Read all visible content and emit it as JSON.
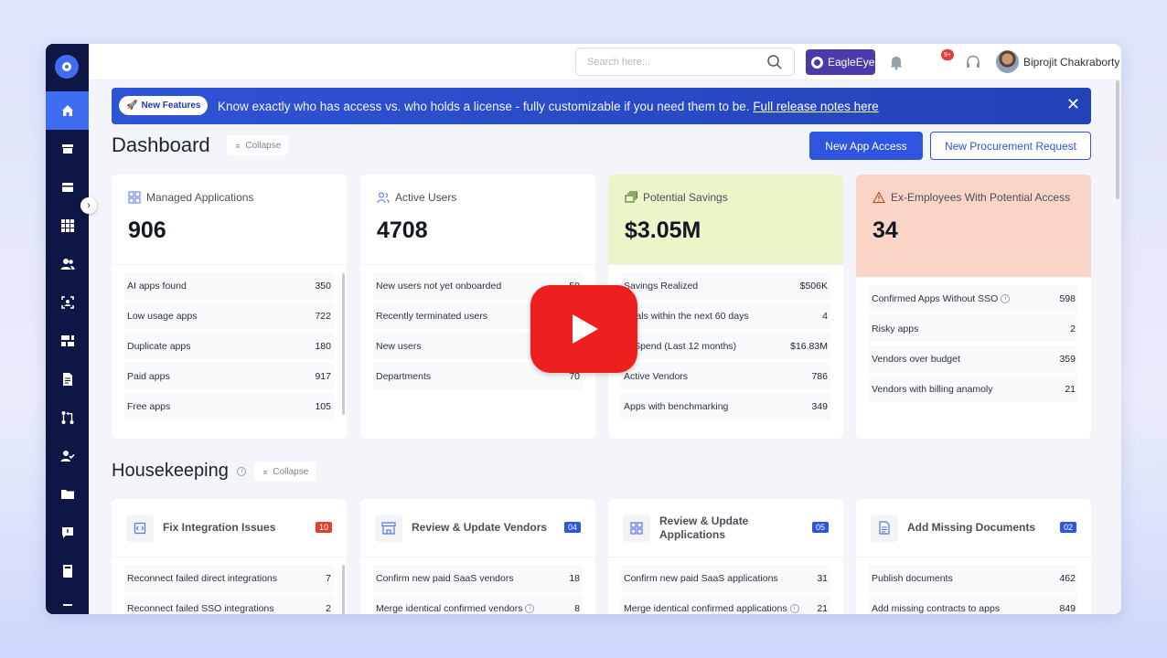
{
  "search": {
    "placeholder": "Search here..."
  },
  "header": {
    "brand_label": "EagleEye",
    "notif_count": "9+",
    "user_name": "Biprojit Chakraborty"
  },
  "banner": {
    "pill": "New Features",
    "message": "Know exactly who has access vs. who holds a license - fully customizable if you need them to be.",
    "link": "Full release notes here"
  },
  "dashboard": {
    "title": "Dashboard",
    "collapse_label": "Collapse",
    "new_app_access": "New App Access",
    "new_procurement": "New Procurement Request"
  },
  "cards": [
    {
      "title": "Managed Applications",
      "value": "906",
      "rows": [
        {
          "label": "AI apps found",
          "value": "350"
        },
        {
          "label": "Low usage apps",
          "value": "722"
        },
        {
          "label": "Duplicate apps",
          "value": "180"
        },
        {
          "label": "Paid apps",
          "value": "917"
        },
        {
          "label": "Free apps",
          "value": "105"
        }
      ]
    },
    {
      "title": "Active Users",
      "value": "4708",
      "rows": [
        {
          "label": "New users not yet onboarded",
          "value": "50"
        },
        {
          "label": "Recently terminated users",
          "value": ""
        },
        {
          "label": "New users",
          "value": ""
        },
        {
          "label": "Departments",
          "value": "70"
        }
      ]
    },
    {
      "title": "Potential Savings",
      "value": "$3.05M",
      "rows": [
        {
          "label": "Savings Realized",
          "value": "$506K"
        },
        {
          "label": "ewals within the next 60 days",
          "value": "4"
        },
        {
          "label": "al Spend (Last 12 months)",
          "value": "$16.83M"
        },
        {
          "label": "Active Vendors",
          "value": "786"
        },
        {
          "label": "Apps with benchmarking",
          "value": "349"
        }
      ]
    },
    {
      "title": "Ex-Employees With Potential Access",
      "value": "34",
      "rows": [
        {
          "label": "Confirmed Apps Without SSO",
          "value": "598"
        },
        {
          "label": "Risky apps",
          "value": "2"
        },
        {
          "label": "Vendors over budget",
          "value": "359"
        },
        {
          "label": "Vendors with billing anamoly",
          "value": "21"
        }
      ]
    }
  ],
  "housekeeping": {
    "title": "Housekeeping",
    "collapse_label": "Collapse",
    "cards": [
      {
        "title": "Fix Integration Issues",
        "count": "10",
        "rows": [
          {
            "label": "Reconnect failed direct integrations",
            "value": "7"
          },
          {
            "label": "Reconnect failed SSO integrations",
            "value": "2"
          }
        ]
      },
      {
        "title": "Review & Update Vendors",
        "count": "04",
        "rows": [
          {
            "label": "Confirm new paid SaaS vendors",
            "value": "18"
          },
          {
            "label": "Merge identical confirmed vendors",
            "value": "8"
          }
        ]
      },
      {
        "title": "Review & Update Applications",
        "count": "05",
        "rows": [
          {
            "label": "Confirm new paid SaaS applications",
            "value": "31"
          },
          {
            "label": "Merge identical confirmed applications",
            "value": "21"
          }
        ]
      },
      {
        "title": "Add Missing Documents",
        "count": "02",
        "rows": [
          {
            "label": "Publish documents",
            "value": "462"
          },
          {
            "label": "Add missing contracts to apps",
            "value": "849"
          }
        ]
      }
    ]
  },
  "colors": {
    "primary": "#2d55e0",
    "sidebar": "#0d1645",
    "savings_bg": "#eaf6c9",
    "exemployee_bg": "#fbd4c8",
    "youtube": "#ee1f1f"
  }
}
